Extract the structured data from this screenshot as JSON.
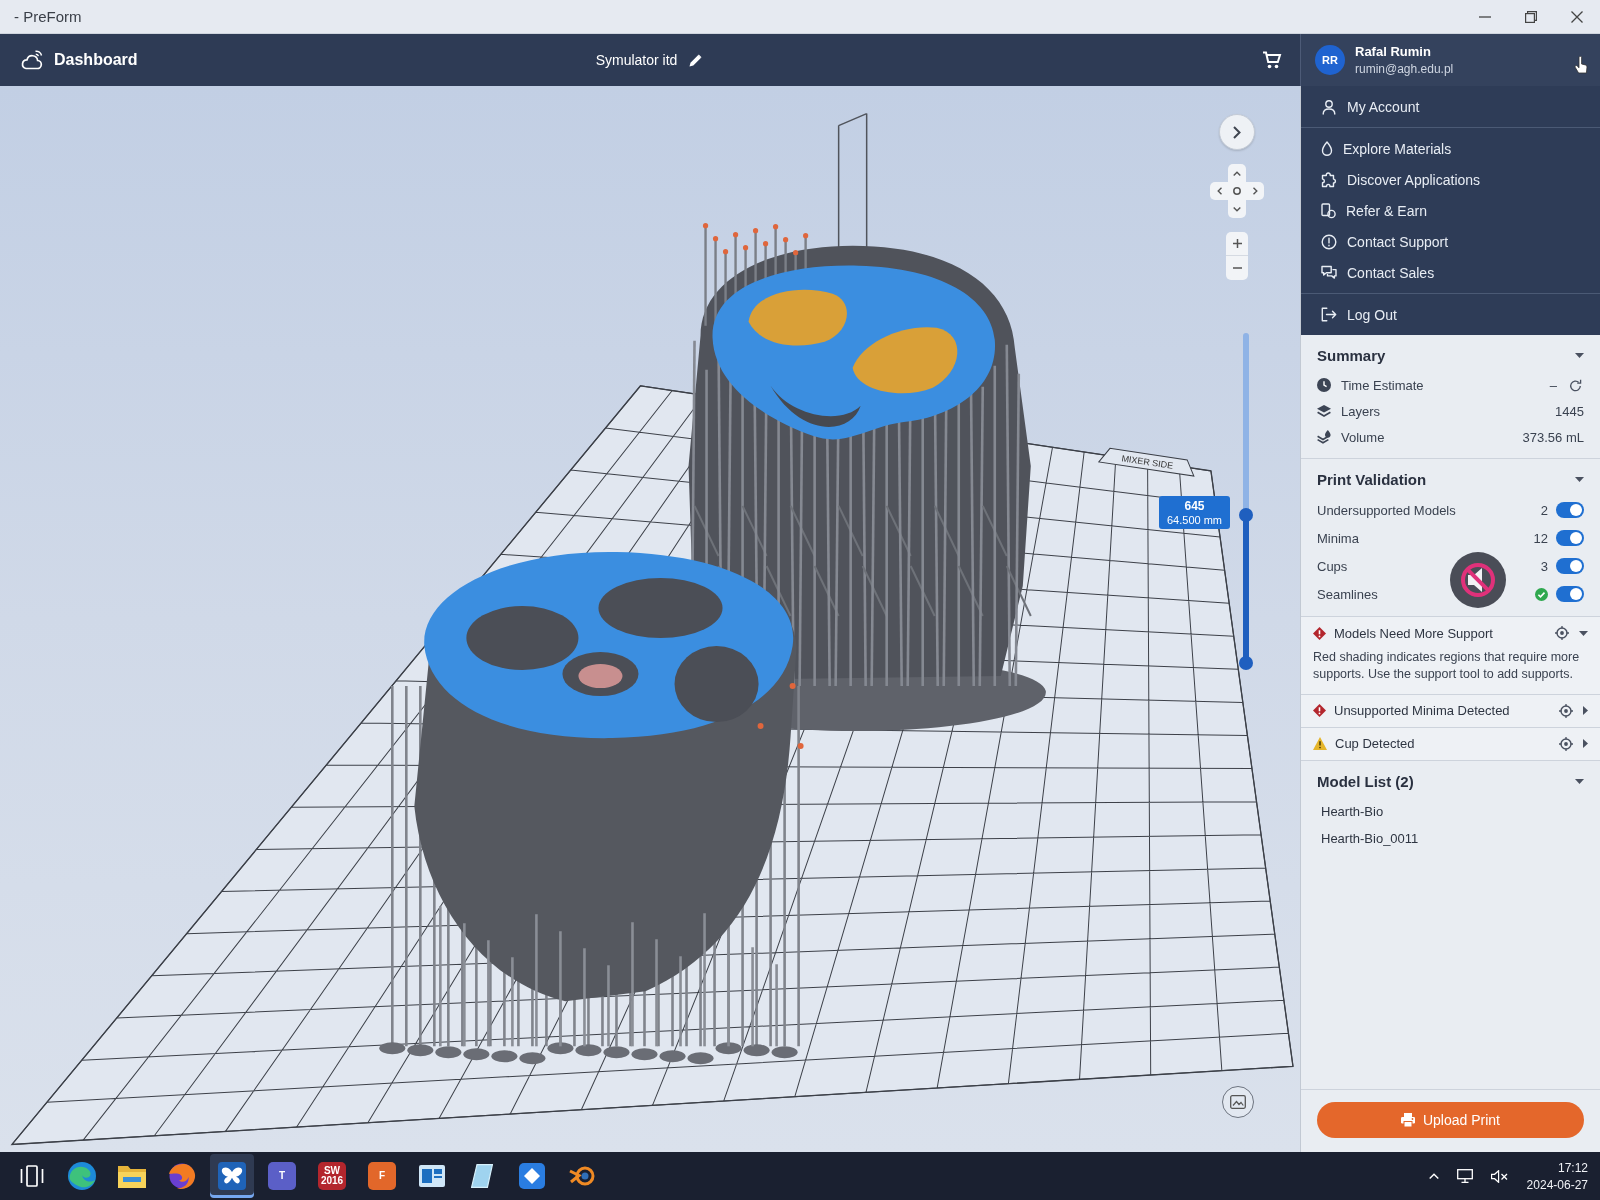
{
  "window": {
    "title": "- PreForm"
  },
  "header": {
    "dashboard": "Dashboard",
    "job_name": "Symulator itd",
    "account": {
      "initials": "RR",
      "name": "Rafal Rumin",
      "email": "rumin@agh.edu.pl"
    }
  },
  "account_menu": {
    "sections": [
      {
        "items": [
          {
            "kind": "account",
            "label": "My Account"
          }
        ]
      },
      {
        "items": [
          {
            "kind": "materials",
            "label": "Explore Materials"
          },
          {
            "kind": "applications",
            "label": "Discover Applications"
          },
          {
            "kind": "referral",
            "label": "Refer & Earn"
          },
          {
            "kind": "support",
            "label": "Contact Support"
          },
          {
            "kind": "sales",
            "label": "Contact Sales"
          }
        ]
      },
      {
        "items": [
          {
            "kind": "logout",
            "label": "Log Out"
          }
        ]
      }
    ]
  },
  "viewport": {
    "plate_label": "MIXER SIDE",
    "layer_slider": {
      "level": 0.45,
      "layer": "645",
      "height": "64.500 mm"
    }
  },
  "summary": {
    "title": "Summary",
    "expanded": true,
    "rows": [
      {
        "kind": "time",
        "label": "Time Estimate",
        "value": "–"
      },
      {
        "kind": "layers",
        "label": "Layers",
        "value": "1445"
      },
      {
        "kind": "volume",
        "label": "Volume",
        "value": "373.56 mL"
      }
    ]
  },
  "print_validation": {
    "title": "Print Validation",
    "expanded": true,
    "checks": [
      {
        "kind": "count",
        "label": "Undersupported Models",
        "count": "2",
        "on": true
      },
      {
        "kind": "count",
        "label": "Minima",
        "count": "12",
        "on": true
      },
      {
        "kind": "count",
        "label": "Cups",
        "count": "3",
        "on": true
      },
      {
        "kind": "passed",
        "label": "Seamlines",
        "on": true
      }
    ],
    "issues": [
      {
        "kind": "error",
        "title": "Models Need More Support",
        "expanded": true,
        "description": "Red shading indicates regions that require more supports. Use the support tool to add supports."
      },
      {
        "kind": "error",
        "title": "Unsupported Minima Detected",
        "expanded": false
      },
      {
        "kind": "warning",
        "title": "Cup Detected",
        "expanded": false
      }
    ]
  },
  "volume_overlay": {
    "muted": true
  },
  "model_list": {
    "title": "Model List (2)",
    "expanded": true,
    "items": [
      {
        "label": "Hearth-Bio",
        "selected": false
      },
      {
        "label": "Hearth-Bio_0011",
        "selected": false
      }
    ]
  },
  "upload_button": {
    "label": "Upload Print"
  },
  "taskbar": {
    "apps": [
      {
        "kind": "taskview",
        "selected": false
      },
      {
        "kind": "swirl",
        "selected": false
      },
      {
        "kind": "folder",
        "selected": false
      },
      {
        "kind": "flame",
        "selected": false
      },
      {
        "kind": "butterfly",
        "selected": true
      },
      {
        "kind": "lettered",
        "text": "T",
        "color": "#5b5fc7",
        "selected": false
      },
      {
        "kind": "lettered",
        "text": "SW 2016",
        "color": "#b3262d",
        "selected": false
      },
      {
        "kind": "lettered",
        "text": "F",
        "color": "#e2672a",
        "selected": false
      },
      {
        "kind": "panel",
        "selected": false
      },
      {
        "kind": "glass",
        "selected": false
      },
      {
        "kind": "diamond",
        "selected": false
      },
      {
        "kind": "orbit",
        "selected": false
      }
    ],
    "tray": {
      "muted": true,
      "time": "17:12",
      "date": "2024-06-27"
    }
  }
}
